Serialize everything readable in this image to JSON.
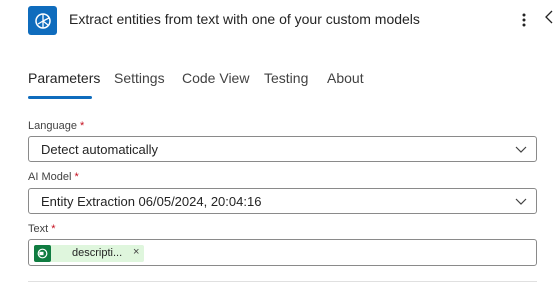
{
  "header": {
    "title": "Extract entities from text with one of your custom models",
    "more_icon": "more-vertical-icon",
    "collapse_icon": "chevron-left-icon",
    "app_icon": "ai-builder-icon",
    "app_color": "#0f6cbd"
  },
  "tabs": [
    {
      "label": "Parameters",
      "active": true
    },
    {
      "label": "Settings"
    },
    {
      "label": "Code View"
    },
    {
      "label": "Testing"
    },
    {
      "label": "About"
    }
  ],
  "fields": {
    "language": {
      "label": "Language",
      "required_mark": "*",
      "value": "Detect automatically"
    },
    "ai_model": {
      "label": "AI Model",
      "required_mark": "*",
      "value": "Entity Extraction 06/05/2024, 20:04:16"
    },
    "text": {
      "label": "Text",
      "required_mark": "*",
      "token_label": "descripti...",
      "token_close": "×",
      "token_icon": "sharepoint-icon"
    }
  },
  "colors": {
    "accent": "#0f6cbd",
    "required": "#c50f1f",
    "token_bg": "#dff6dd",
    "token_icon_bg": "#107c41"
  }
}
